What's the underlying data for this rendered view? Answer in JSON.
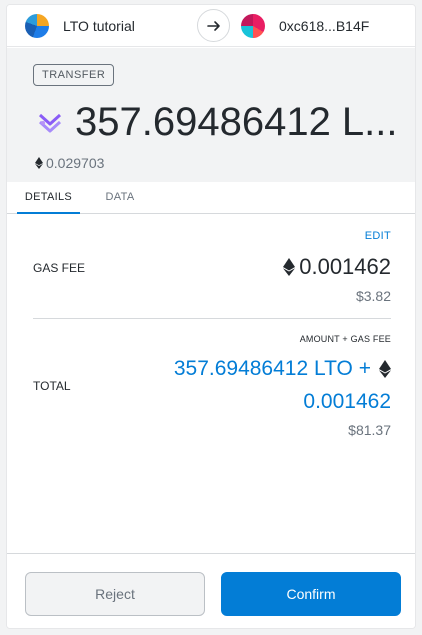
{
  "header": {
    "from_account": "LTO tutorial",
    "to_account": "0xc618...B14F"
  },
  "summary": {
    "action_badge": "TRANSFER",
    "amount": "357.69486412 L...",
    "eth_amount": "0.029703"
  },
  "tabs": [
    {
      "label": "DETAILS",
      "active": true
    },
    {
      "label": "DATA",
      "active": false
    }
  ],
  "details": {
    "edit_label": "EDIT",
    "gas_fee_label": "GAS FEE",
    "gas_fee_eth": "0.001462",
    "gas_fee_usd": "$3.82",
    "amount_gas_fee_label": "AMOUNT + GAS FEE",
    "total_label": "TOTAL",
    "total_token": "357.69486412 LTO +",
    "total_eth": "0.001462",
    "total_usd": "$81.37"
  },
  "footer": {
    "reject_label": "Reject",
    "confirm_label": "Confirm"
  },
  "colors": {
    "accent": "#037dd6",
    "muted": "#6a737d",
    "text": "#24292e",
    "summary_bg": "#f2f3f4",
    "token_icon": "#8a5cf6"
  },
  "icons": {
    "arrow": "arrow-right-icon",
    "eth": "ethereum-icon",
    "token": "lto-token-icon"
  }
}
